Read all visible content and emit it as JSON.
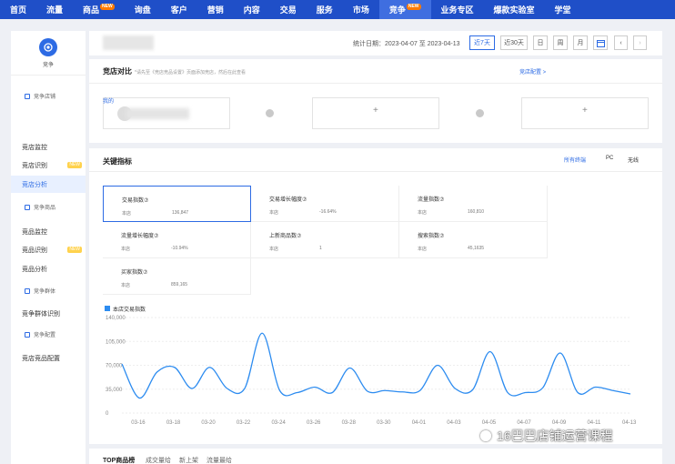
{
  "nav": {
    "items": [
      {
        "label": "首页",
        "badge": ""
      },
      {
        "label": "流量",
        "badge": ""
      },
      {
        "label": "商品",
        "badge": "NEW"
      },
      {
        "label": "询盘",
        "badge": ""
      },
      {
        "label": "客户",
        "badge": ""
      },
      {
        "label": "营销",
        "badge": ""
      },
      {
        "label": "内容",
        "badge": ""
      },
      {
        "label": "交易",
        "badge": ""
      },
      {
        "label": "服务",
        "badge": ""
      },
      {
        "label": "市场",
        "badge": ""
      },
      {
        "label": "竞争",
        "badge": "NEW"
      },
      {
        "label": "业务专区",
        "badge": ""
      },
      {
        "label": "爆款实验室",
        "badge": ""
      },
      {
        "label": "学堂",
        "badge": ""
      }
    ],
    "active_index": 10
  },
  "sidebar": {
    "brand": "竞争",
    "items": [
      {
        "label": "竞争店铺",
        "type": "sub",
        "badge": ""
      },
      {
        "label": "竞店监控",
        "type": "main",
        "badge": ""
      },
      {
        "label": "竞店识别",
        "type": "main",
        "badge": "NEW"
      },
      {
        "label": "竞店分析",
        "type": "main",
        "badge": "",
        "active": true
      },
      {
        "label": "竞争商品",
        "type": "sub",
        "badge": ""
      },
      {
        "label": "竞品监控",
        "type": "main",
        "badge": ""
      },
      {
        "label": "竞品识别",
        "type": "main",
        "badge": "NEW"
      },
      {
        "label": "竞品分析",
        "type": "main",
        "badge": ""
      },
      {
        "label": "竞争群体",
        "type": "sub",
        "badge": ""
      },
      {
        "label": "竞争群体识别",
        "type": "main",
        "badge": ""
      },
      {
        "label": "竞争配置",
        "type": "sub",
        "badge": ""
      },
      {
        "label": "竞店竞品配置",
        "type": "main",
        "badge": ""
      }
    ]
  },
  "header": {
    "stat_date": "统计日期：2023-04-07 至 2023-04-13",
    "ranges": [
      "近7天",
      "近30天",
      "日",
      "周",
      "月"
    ],
    "active_range": 0
  },
  "compare": {
    "title": "竞店对比",
    "note": "*请先至《竞店竞品设置》页面添加竞店，然后在此查看",
    "config_link": "竞店配置 >",
    "my_shop_tag": "我的",
    "plus": "+"
  },
  "kpi": {
    "title": "关键指标",
    "terminals": [
      "所有终端",
      "PC",
      "无线"
    ],
    "active_terminal": 0,
    "metrics": [
      {
        "name": "交易指数⑦",
        "label": "本店",
        "value": "136,847"
      },
      {
        "name": "交易增长幅度⑦",
        "label": "本店",
        "value": "-16.64%"
      },
      {
        "name": "流量指数⑦",
        "label": "本店",
        "value": "160,810"
      },
      {
        "name": "流量增长幅度⑦",
        "label": "本店",
        "value": "-10.94%"
      },
      {
        "name": "上新商品数⑦",
        "label": "本店",
        "value": "1"
      },
      {
        "name": "搜索指数⑦",
        "label": "本店",
        "value": "45,1635"
      },
      {
        "name": "买家指数⑦",
        "label": "本店",
        "value": "859,165"
      }
    ],
    "legend": "本店交易指数"
  },
  "chart_data": {
    "type": "line",
    "title": "",
    "xlabel": "",
    "ylabel": "",
    "ylim": [
      0,
      140000
    ],
    "yticks": [
      "0",
      "35,000",
      "70,000",
      "105,000",
      "140,000"
    ],
    "x": [
      "03-15",
      "03-16",
      "03-17",
      "03-18",
      "03-19",
      "03-20",
      "03-21",
      "03-22",
      "03-23",
      "03-24",
      "03-25",
      "03-26",
      "03-27",
      "03-28",
      "03-29",
      "03-30",
      "03-31",
      "04-01",
      "04-02",
      "04-03",
      "04-04",
      "04-05",
      "04-06",
      "04-07",
      "04-08",
      "04-09",
      "04-10",
      "04-11",
      "04-12",
      "04-13"
    ],
    "xticks": [
      "03-16",
      "03-18",
      "03-20",
      "03-22",
      "03-24",
      "03-26",
      "03-28",
      "03-30",
      "04-01",
      "04-03",
      "04-05",
      "04-07",
      "04-09",
      "04-11",
      "04-13"
    ],
    "series": [
      {
        "name": "本店交易指数",
        "color": "#2d8cf0",
        "values": [
          72000,
          22000,
          60000,
          67000,
          36000,
          67000,
          36000,
          36000,
          117000,
          33000,
          30000,
          38000,
          30000,
          66000,
          32000,
          33000,
          31000,
          33000,
          70000,
          36000,
          34000,
          90000,
          30000,
          30000,
          37000,
          88000,
          30000,
          38000,
          33000,
          28000
        ]
      }
    ],
    "grid": true
  },
  "bottom": {
    "title": "TOP商品榜",
    "tabs": [
      "成交量给",
      "新上架",
      "流量最给"
    ]
  },
  "watermark": "16巴巴店铺运营课程"
}
